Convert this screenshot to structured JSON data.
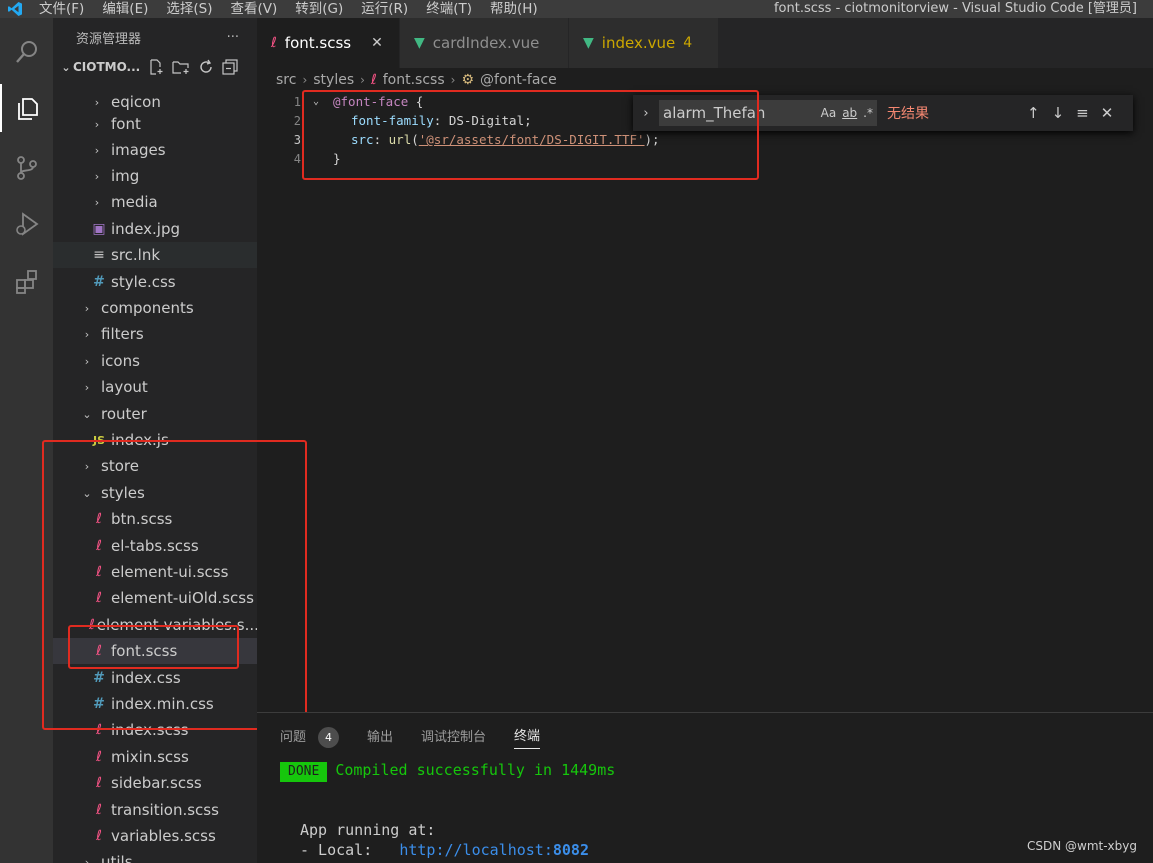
{
  "window": {
    "title": "font.scss - ciotmonitorview - Visual Studio Code [管理员]",
    "menu": [
      "文件(F)",
      "编辑(E)",
      "选择(S)",
      "查看(V)",
      "转到(G)",
      "运行(R)",
      "终端(T)",
      "帮助(H)"
    ]
  },
  "sidebar": {
    "title": "资源管理器",
    "more": "···",
    "project": "CIOTMO...",
    "items": [
      {
        "label": "eqicon",
        "type": "folder"
      },
      {
        "label": "font",
        "type": "folder"
      },
      {
        "label": "images",
        "type": "folder"
      },
      {
        "label": "img",
        "type": "folder"
      },
      {
        "label": "media",
        "type": "folder"
      },
      {
        "label": "index.jpg",
        "type": "image"
      },
      {
        "label": "src.lnk",
        "type": "file"
      },
      {
        "label": "style.css",
        "type": "css"
      },
      {
        "label": "components",
        "type": "folder"
      },
      {
        "label": "filters",
        "type": "folder"
      },
      {
        "label": "icons",
        "type": "folder"
      },
      {
        "label": "layout",
        "type": "folder"
      },
      {
        "label": "router",
        "type": "folder-open"
      },
      {
        "label": "index.js",
        "type": "js"
      },
      {
        "label": "store",
        "type": "folder"
      },
      {
        "label": "styles",
        "type": "folder-open"
      },
      {
        "label": "btn.scss",
        "type": "scss"
      },
      {
        "label": "el-tabs.scss",
        "type": "scss"
      },
      {
        "label": "element-ui.scss",
        "type": "scss"
      },
      {
        "label": "element-uiOld.scss",
        "type": "scss"
      },
      {
        "label": "element-variables.s...",
        "type": "scss"
      },
      {
        "label": "font.scss",
        "type": "scss"
      },
      {
        "label": "index.css",
        "type": "css"
      },
      {
        "label": "index.min.css",
        "type": "css"
      },
      {
        "label": "index.scss",
        "type": "scss"
      },
      {
        "label": "mixin.scss",
        "type": "scss"
      },
      {
        "label": "sidebar.scss",
        "type": "scss"
      },
      {
        "label": "transition.scss",
        "type": "scss"
      },
      {
        "label": "variables.scss",
        "type": "scss"
      },
      {
        "label": "utils",
        "type": "folder"
      }
    ]
  },
  "tabs": [
    {
      "label": "font.scss",
      "close": "✕"
    },
    {
      "label": "cardIndex.vue"
    },
    {
      "label": "index.vue",
      "count": "4"
    }
  ],
  "breadcrumb": [
    "src",
    "styles",
    "font.scss",
    "@font-face"
  ],
  "editor": {
    "line_numbers": [
      "1",
      "2",
      "3",
      "4"
    ],
    "l1_at": "@font-face",
    "l1_brace": " {",
    "l2_prop": "font-family",
    "l2_val": ": DS-Digital;",
    "l3_prop": "src",
    "l3_colon": ": ",
    "l3_fn": "url",
    "l3_open": "(",
    "l3_str": "'@sr/assets/font/DS-DIGIT.TTF'",
    "l3_close": ");",
    "l4_brace": "}"
  },
  "find": {
    "query": "alarm_Thefan",
    "match_case": "Aa",
    "whole_word": "ab",
    "regex": ".*",
    "result": "无结果"
  },
  "panel": {
    "tabs": [
      "问题",
      "输出",
      "调试控制台",
      "终端"
    ],
    "problems_count": "4",
    "done_badge": "DONE",
    "compiled_msg": "Compiled successfully in 1449ms",
    "running": "App running at:",
    "local_label": "- Local:   ",
    "local_url": "http://localhost:",
    "local_port": "8082"
  },
  "watermark": "CSDN @wmt-xbyg",
  "colors": {
    "accent_red": "#e02b20",
    "scss_icon": "#f55385",
    "css_icon": "#519aba",
    "js_icon": "#cbcb41",
    "vue_icon": "#41b883"
  }
}
